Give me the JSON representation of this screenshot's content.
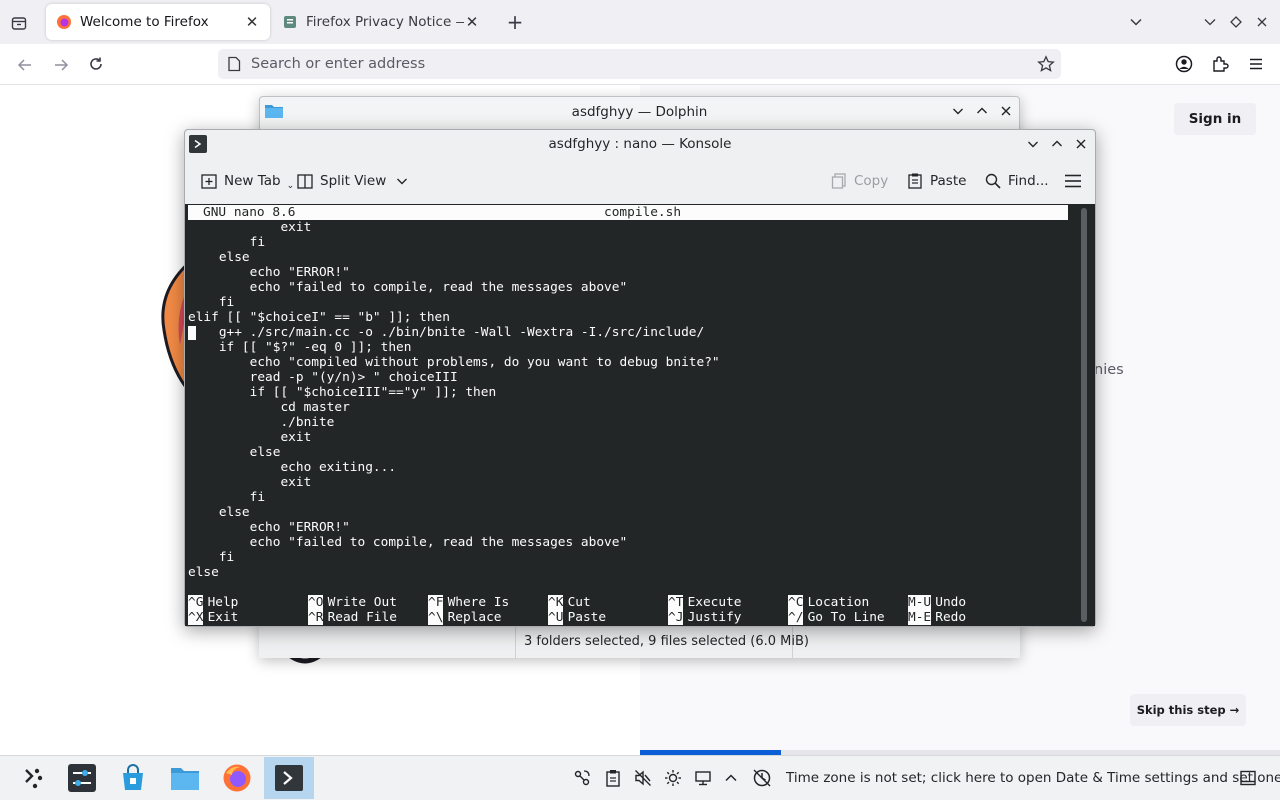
{
  "firefox": {
    "tabs": [
      {
        "title": "Welcome to Firefox",
        "active": true
      },
      {
        "title": "Firefox Privacy Notice — M",
        "active": false
      }
    ],
    "url_placeholder": "Search or enter address",
    "sign_in_label": "Sign in",
    "skip_step_label": "Skip this step →",
    "partial_text": "nies",
    "onboarding_progress": 0.22
  },
  "dolphin": {
    "title": "asdfghyy — Dolphin",
    "status": "3 folders selected, 9 files selected (6.0 MiB)"
  },
  "konsole": {
    "title": "asdfghyy : nano — Konsole",
    "toolbar": {
      "new_tab": "New Tab",
      "split_view": "Split View",
      "copy": "Copy",
      "paste": "Paste",
      "find": "Find..."
    },
    "nano": {
      "version": "GNU nano 8.6",
      "filename": "compile.sh",
      "lines": [
        "            exit",
        "        fi",
        "    else",
        "        echo \"ERROR!\"",
        "        echo \"failed to compile, read the messages above\"",
        "    fi",
        "elif [[ \"$choiceI\" == \"b\" ]]; then",
        "    g++ ./src/main.cc -o ./bin/bnite -Wall -Wextra -I./src/include/",
        "    if [[ \"$?\" -eq 0 ]]; then",
        "        echo \"compiled without problems, do you want to debug bnite?\"",
        "        read -p \"(y/n)> \" choiceIII",
        "        if [[ \"$choiceIII\"==\"y\" ]]; then",
        "            cd master",
        "            ./bnite",
        "            exit",
        "        else",
        "            echo exiting...",
        "            exit",
        "        fi",
        "    else",
        "        echo \"ERROR!\"",
        "        echo \"failed to compile, read the messages above\"",
        "    fi",
        "else"
      ],
      "shortcuts": [
        {
          "key1": "^G",
          "label1": "Help",
          "key2": "^X",
          "label2": "Exit"
        },
        {
          "key1": "^O",
          "label1": "Write Out",
          "key2": "^R",
          "label2": "Read File"
        },
        {
          "key1": "^F",
          "label1": "Where Is",
          "key2": "^\\",
          "label2": "Replace"
        },
        {
          "key1": "^K",
          "label1": "Cut",
          "key2": "^U",
          "label2": "Paste"
        },
        {
          "key1": "^T",
          "label1": "Execute",
          "key2": "^J",
          "label2": "Justify"
        },
        {
          "key1": "^C",
          "label1": "Location",
          "key2": "^/",
          "label2": "Go To Line"
        },
        {
          "key1": "M-U",
          "label1": "Undo",
          "key2": "M-E",
          "label2": "Redo"
        }
      ]
    }
  },
  "taskbar": {
    "tray_text": "Time zone is not set; click here to open Date & Time settings and set one"
  },
  "colors": {
    "terminal_bg": "#232627",
    "terminal_fg": "#fcfcfc",
    "firefox_accent": "#0a5fd6",
    "task_active": "#b6d6f0"
  }
}
